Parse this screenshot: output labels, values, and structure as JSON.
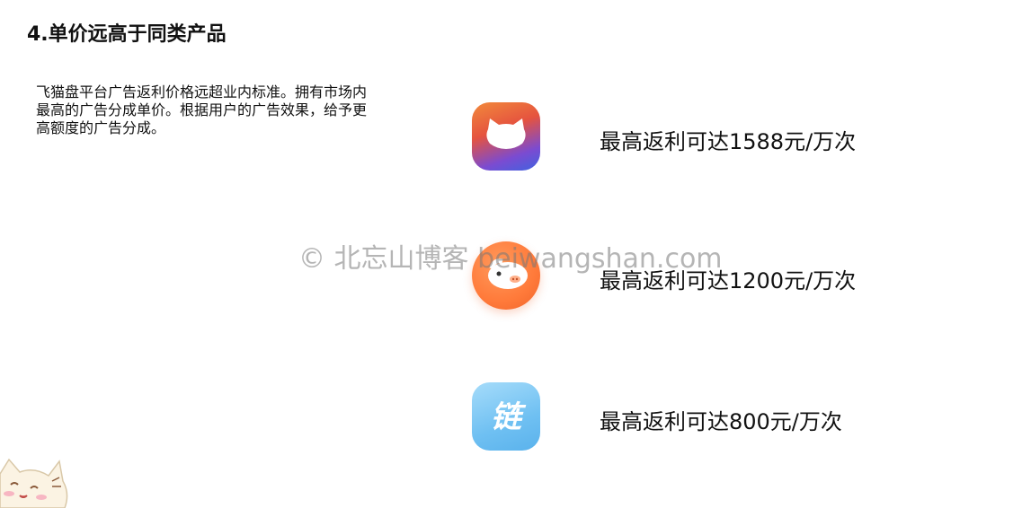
{
  "slide": {
    "title": "4.单价远高于同类产品",
    "description": "飞猫盘平台广告返利价格远超业内标准。拥有市场内最高的广告分成单价。根据用户的广告效果，给予更高额度的广告分成。"
  },
  "products": [
    {
      "icon": "cat-app-icon",
      "rebate_text": "最高返利可达1588元/万次"
    },
    {
      "icon": "pig-app-icon",
      "rebate_text": "最高返利可达1200元/万次"
    },
    {
      "icon": "link-app-icon",
      "icon_glyph": "链",
      "rebate_text": "最高返利可达800元/万次"
    }
  ],
  "watermark": "© 北忘山博客 beiwangshan.com",
  "colors": {
    "cat_icon_gradient": [
      "#f28a3b",
      "#e5533f",
      "#7b4bd1",
      "#3f63e0"
    ],
    "pig_icon": "#ff7a3a",
    "link_icon": "#6fc0f2"
  }
}
